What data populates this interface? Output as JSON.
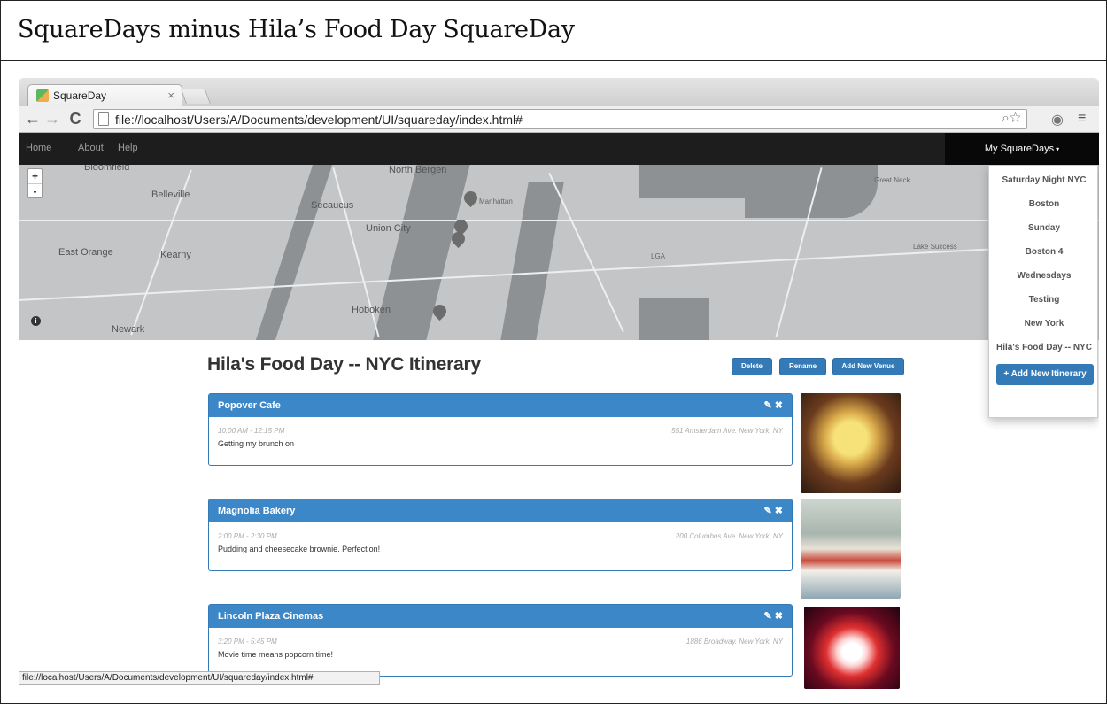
{
  "document": {
    "title": "SquareDays minus Hila’s Food Day SquareDay"
  },
  "browser": {
    "tab_title": "SquareDay",
    "tab_close": "×",
    "url": "file://localhost/Users/A/Documents/development/UI/squareday/index.html#",
    "status_url": "file://localhost/Users/A/Documents/development/UI/squareday/index.html#",
    "icons": [
      "back-icon",
      "forward-icon",
      "reload-icon",
      "page-icon",
      "zoom-icon",
      "star-icon",
      "extension-icon",
      "menu-icon"
    ]
  },
  "navbar": {
    "links": [
      "Home",
      "About",
      "Help"
    ],
    "my_squaredays": "My SquareDays"
  },
  "map": {
    "labels": [
      "Bloomfield",
      "Belleville",
      "North Bergen",
      "Secaucus",
      "Union City",
      "East Orange",
      "Kearny",
      "Hoboken",
      "Newark",
      "Great Neck",
      "Lake Success",
      "Manhattan",
      "LGA"
    ],
    "zoom_in": "+",
    "zoom_out": "-",
    "info": "i"
  },
  "dropdown": {
    "items": [
      "Saturday Night NYC",
      "Boston",
      "Sunday",
      "Boston 4",
      "Wednesdays",
      "Testing",
      "New York",
      "Hila's Food Day -- NYC"
    ],
    "add_button": "+ Add New Itinerary"
  },
  "itinerary": {
    "title": "Hila's Food Day -- NYC Itinerary",
    "buttons": {
      "delete": "Delete",
      "rename": "Rename",
      "add_venue": "Add New Venue"
    },
    "venues": [
      {
        "name": "Popover Cafe",
        "time": "10:00 AM - 12:15 PM",
        "address": "551 Amsterdam Ave. New York, NY",
        "description": "Getting my brunch on"
      },
      {
        "name": "Magnolia Bakery",
        "time": "2:00 PM - 2:30 PM",
        "address": "200 Columbus Ave. New York, NY",
        "description": "Pudding and cheesecake brownie. Perfection!"
      },
      {
        "name": "Lincoln Plaza Cinemas",
        "time": "3:20 PM - 5:45 PM",
        "address": "1886 Broadway. New York, NY",
        "description": "Movie time means popcorn time!"
      }
    ],
    "venue_actions": "✎ ✖"
  },
  "colors": {
    "primary": "#337ab7",
    "panel_header": "#3c87c7",
    "navbar": "#1d1d1d"
  }
}
